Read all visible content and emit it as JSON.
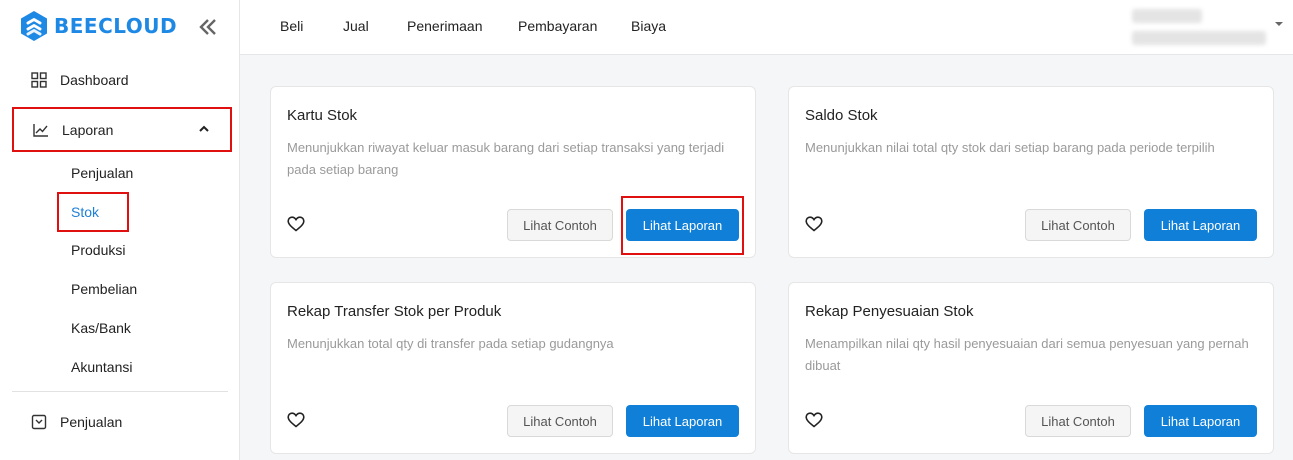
{
  "brand": {
    "name": "BEECLOUD",
    "color": "#1e88e5"
  },
  "sidebar": {
    "collapse_icon": "double-chevron-left-icon",
    "items": [
      {
        "label": "Dashboard",
        "icon": "grid-icon"
      },
      {
        "label": "Laporan",
        "icon": "line-chart-icon",
        "expanded": true
      },
      {
        "label": "Penjualan",
        "icon": "receipt-icon"
      }
    ],
    "laporan_sub": [
      "Penjualan",
      "Stok",
      "Produksi",
      "Pembelian",
      "Kas/Bank",
      "Akuntansi"
    ],
    "active_sub": "Stok"
  },
  "topbar": {
    "menu": [
      "Beli",
      "Jual",
      "Penerimaan",
      "Pembayaran",
      "Biaya"
    ]
  },
  "cards": [
    {
      "title": "Kartu Stok",
      "desc": "Menunjukkan riwayat keluar masuk barang dari setiap transaksi yang terjadi pada setiap barang",
      "btn_example": "Lihat Contoh",
      "btn_report": "Lihat Laporan"
    },
    {
      "title": "Saldo Stok",
      "desc": "Menunjukkan nilai total qty stok dari setiap barang pada periode terpilih",
      "btn_example": "Lihat Contoh",
      "btn_report": "Lihat Laporan"
    },
    {
      "title": "Rekap Transfer Stok per Produk",
      "desc": "Menunjukkan total qty di transfer pada setiap gudangnya",
      "btn_example": "Lihat Contoh",
      "btn_report": "Lihat Laporan"
    },
    {
      "title": "Rekap Penyesuaian Stok",
      "desc": "Menampilkan nilai qty hasil penyesuaian dari semua penyesuan yang pernah dibuat",
      "btn_example": "Lihat Contoh",
      "btn_report": "Lihat Laporan"
    }
  ],
  "colors": {
    "primary": "#0f7fd8",
    "highlight": "#e01010",
    "active_link": "#1e7fd6"
  }
}
